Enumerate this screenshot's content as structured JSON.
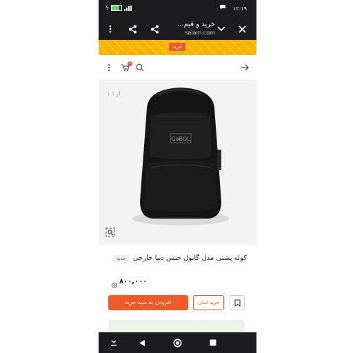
{
  "status_bar": {
    "time": "۱۲:۱۹",
    "battery_level": 0.8,
    "signal_bars": 4
  },
  "browser": {
    "page_title": "خرید و قیم...",
    "url": "salam.com"
  },
  "banner": {
    "button_label": "خرید"
  },
  "nav": {
    "cart_count": "1"
  },
  "gallery": {
    "counter": "۱ از ۱",
    "brand_text": "GaBOL"
  },
  "product": {
    "title": "کوله پشتی مدل گابول جنس دبیا خارجی",
    "badge": "جدید",
    "price": "۸۰۰,۰۰۰"
  },
  "actions": {
    "buy_label": "افزودن به سبد خرید",
    "easy_buy_label": "خرید آسان"
  },
  "colors": {
    "accent": "#ef5a2b",
    "banner": "#f7b500",
    "chrome": "#1c1c1e",
    "info_box": "#e9f4e9"
  }
}
